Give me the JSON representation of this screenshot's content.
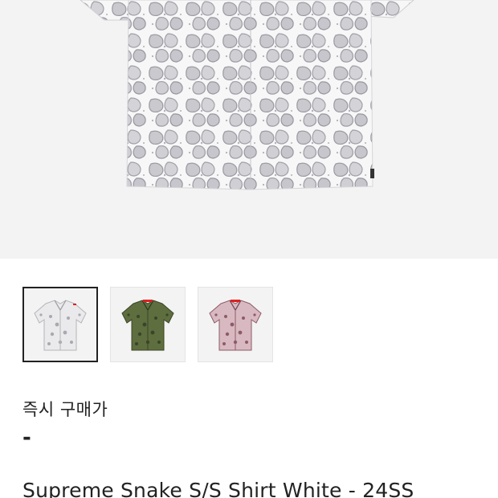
{
  "product": {
    "main_image": "product-photo",
    "thumbnails": [
      {
        "name": "white",
        "color": "#e6e6e8",
        "pattern": "#a9a9b0",
        "collar": "#ffffff",
        "accent": "#d22"
      },
      {
        "name": "olive",
        "color": "#5e6e3e",
        "pattern": "#39452a",
        "collar": "#5e6e3e",
        "accent": "#d22"
      },
      {
        "name": "pink",
        "color": "#d9b9c1",
        "pattern": "#8d5b68",
        "collar": "#d9b9c1",
        "accent": "#d22"
      }
    ],
    "selected_thumbnail": 0,
    "price_label": "즉시 구매가",
    "price_value": "-",
    "title": "Supreme Snake S/S Shirt White - 24SS"
  }
}
